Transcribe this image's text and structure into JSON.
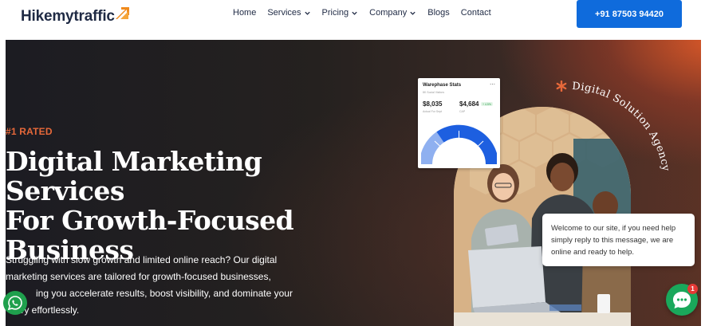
{
  "nav": {
    "logo_text": "Hikemytraffic",
    "menu": [
      {
        "label": "Home",
        "has_dropdown": false
      },
      {
        "label": "Services",
        "has_dropdown": true
      },
      {
        "label": "Pricing",
        "has_dropdown": true
      },
      {
        "label": "Company",
        "has_dropdown": true
      },
      {
        "label": "Blogs",
        "has_dropdown": false
      },
      {
        "label": "Contact",
        "has_dropdown": false
      }
    ],
    "cta_label": "+91 87503 94420"
  },
  "hero": {
    "rated_label": "#1 RATED",
    "headline_line1": "Digital Marketing Services",
    "headline_line2": "For Growth-Focused",
    "headline_line3": "Business",
    "paragraph_line1": "Struggling with slow growth and limited online reach? Our digital",
    "paragraph_line2": "marketing services are tailored for growth-focused businesses,",
    "paragraph_line3": "ing you accelerate results, boost visibility, and dominate your",
    "paragraph_line4": "stry effortlessly.",
    "badge_text": "Digital Solution Agency"
  },
  "stats_card": {
    "title": "Warephase Stats",
    "menu_icon": "more-dots-icon",
    "subtitle": "8K Social Visitors",
    "value1": "$8,035",
    "label1": "Actual For Sept",
    "value2": "$4,684",
    "change_badge": "+ 4.5%",
    "label2": "CAP"
  },
  "chat": {
    "message": "Welcome to our site, if you need help simply reply to this message, we are online and ready to help.",
    "unread_count": "1"
  },
  "colors": {
    "accent_orange": "#e6683a",
    "cta_blue": "#0f6bdc",
    "whatsapp_green": "#1fa04d",
    "chat_green": "#1aa85b",
    "gauge_blue": "#1d5fe0"
  }
}
